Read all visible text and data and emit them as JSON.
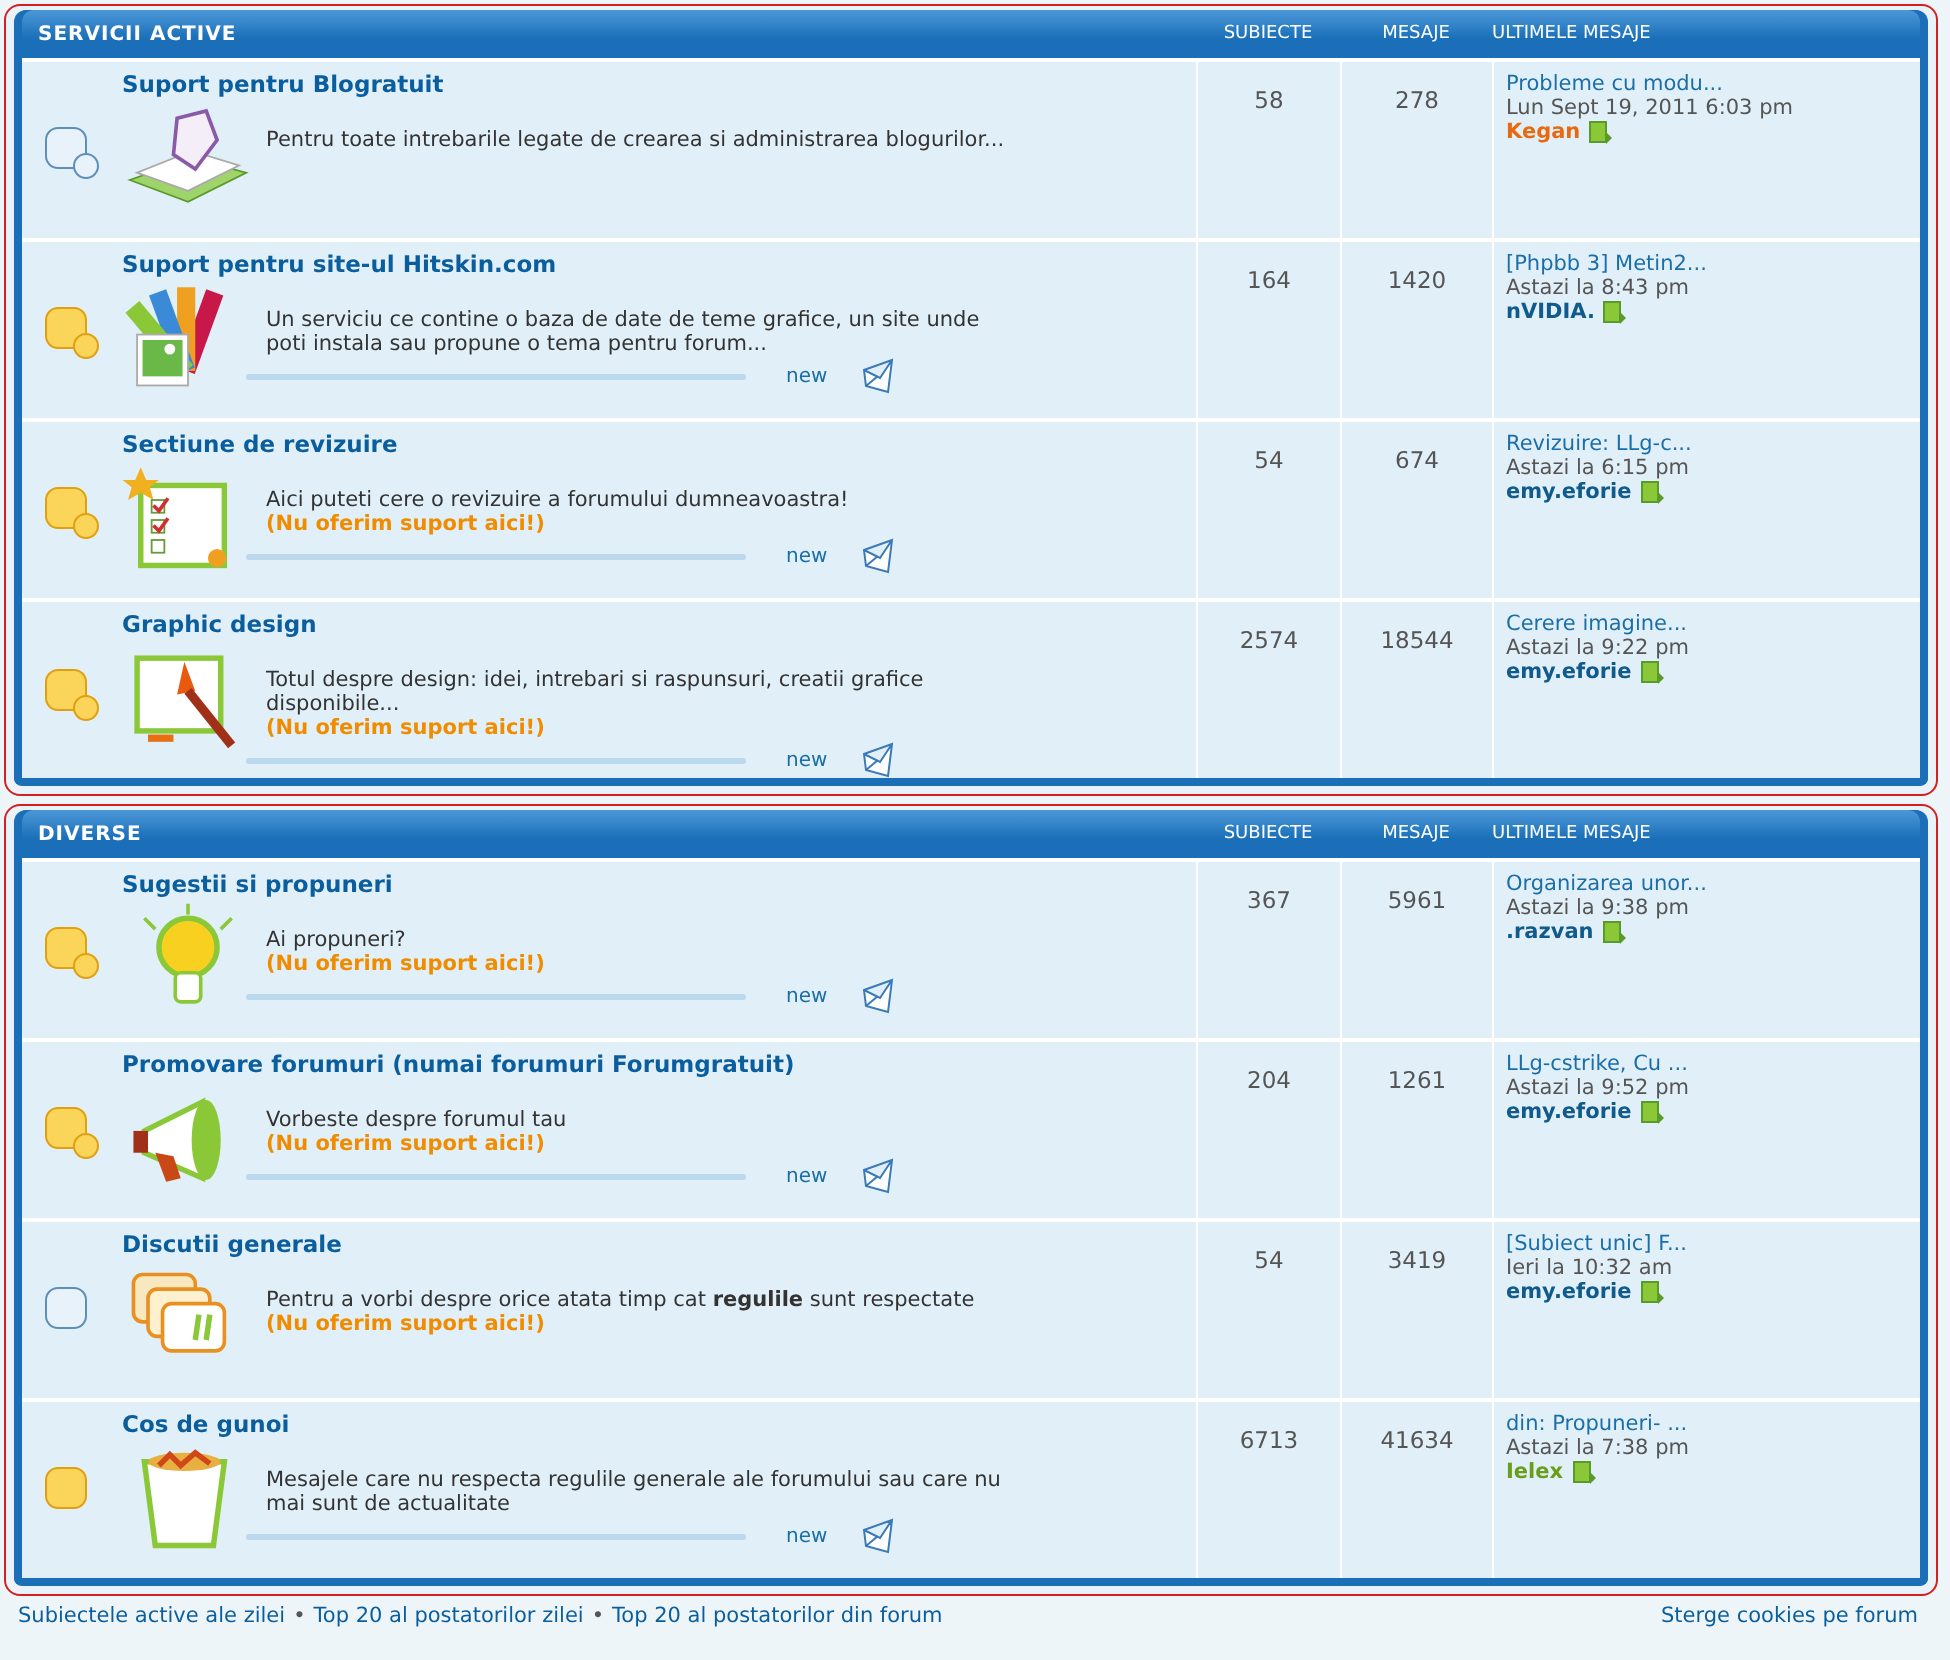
{
  "categories": [
    {
      "title": "SERVICII ACTIVE",
      "columns": [
        "SUBIECTE",
        "MESAJE",
        "ULTIMELE MESAJE"
      ],
      "forums": [
        {
          "title": "Suport pentru Blogratuit",
          "unread": false,
          "subforums": true,
          "kind": "book",
          "description": "Pentru toate intrebarile legate de crearea si administrarea blogurilor...",
          "topics": "58",
          "posts": "278",
          "last_topic": "Probleme cu modu...",
          "last_date": "Lun Sept 19, 2011 6:03 pm",
          "last_author": "Kegan",
          "color": "#e86a10"
        },
        {
          "title": "Suport pentru site-ul Hitskin.com",
          "unread": true,
          "subforums": true,
          "kind": "palette",
          "description": "Un serviciu ce contine o baza de date de teme grafice, un site unde poti instala sau propune o tema pentru forum...",
          "new_label": "new",
          "topics": "164",
          "posts": "1420",
          "last_topic": "[Phpbb 3] Metin2...",
          "last_date": "Astazi la 8:43 pm",
          "last_author": "nVIDIA.",
          "color": "#105a8c"
        },
        {
          "title": "Sectiune de revizuire",
          "unread": true,
          "subforums": true,
          "kind": "checklist",
          "description": "Aici puteti cere o revizuire a forumului dumneavoastra!",
          "notice": "(Nu oferim suport aici!)",
          "new_label": "new",
          "topics": "54",
          "posts": "674",
          "last_topic": "Revizuire: LLg-c...",
          "last_date": "Astazi la 6:15 pm",
          "last_author": "emy.eforie",
          "color": "#105a8c"
        },
        {
          "title": "Graphic design",
          "unread": true,
          "subforums": true,
          "kind": "easel",
          "description": "Totul despre design: idei, intrebari si raspunsuri, creatii grafice disponibile...",
          "notice": "(Nu oferim suport aici!)",
          "new_label": "new",
          "topics": "2574",
          "posts": "18544",
          "last_topic": "Cerere imagine...",
          "last_date": "Astazi la 9:22 pm",
          "last_author": "emy.eforie",
          "color": "#105a8c"
        }
      ]
    },
    {
      "title": "DIVERSE",
      "columns": [
        "SUBIECTE",
        "MESAJE",
        "ULTIMELE MESAJE"
      ],
      "forums": [
        {
          "title": "Sugestii si propuneri",
          "unread": true,
          "subforums": true,
          "kind": "bulb",
          "description": "Ai propuneri?",
          "notice": "(Nu oferim suport aici!)",
          "new_label": "new",
          "topics": "367",
          "posts": "5961",
          "last_topic": "Organizarea unor...",
          "last_date": "Astazi la 9:38 pm",
          "last_author": ".razvan",
          "color": "#105a8c"
        },
        {
          "title": "Promovare forumuri (numai forumuri Forumgratuit)",
          "unread": true,
          "subforums": true,
          "kind": "megaphone",
          "description": "Vorbeste despre forumul tau",
          "notice": "(Nu oferim suport aici!)",
          "new_label": "new",
          "topics": "204",
          "posts": "1261",
          "last_topic": "LLg-cstrike, Cu ...",
          "last_date": "Astazi la 9:52 pm",
          "last_author": "emy.eforie",
          "color": "#105a8c"
        },
        {
          "title": "Discutii generale",
          "unread": false,
          "subforums": false,
          "kind": "chat",
          "description": "Pentru a vorbi despre orice atata timp cat **regulile** sunt respectate",
          "notice": "(Nu oferim suport aici!)",
          "topics": "54",
          "posts": "3419",
          "last_topic": "[Subiect unic] F...",
          "last_date": "Ieri la 10:32 am",
          "last_author": "emy.eforie",
          "color": "#105a8c"
        },
        {
          "title": "Cos de gunoi",
          "unread": true,
          "subforums": false,
          "kind": "trash",
          "description": "Mesajele care nu respecta regulile generale ale forumului sau care nu mai sunt de actualitate",
          "new_label": "new",
          "topics": "6713",
          "posts": "41634",
          "last_topic": "din: Propuneri- ...",
          "last_date": "Astazi la 7:38 pm",
          "last_author": "Ielex",
          "color": "#6a9e1a"
        }
      ]
    }
  ],
  "footer": {
    "links": [
      "Subiectele active ale zilei",
      "Top 20 al postatorilor zilei",
      "Top 20 al postatorilor din forum"
    ],
    "separator": "•",
    "right_link": "Sterge cookies pe forum"
  }
}
